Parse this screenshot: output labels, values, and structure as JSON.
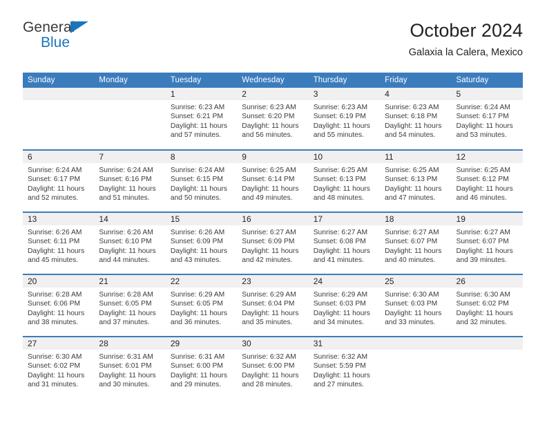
{
  "logo": {
    "word1": "General",
    "word2": "Blue",
    "triangle_color": "#1b75bb"
  },
  "header": {
    "title": "October 2024",
    "subtitle": "Galaxia la Calera, Mexico"
  },
  "colors": {
    "header_blue": "#3b7cbd",
    "daynum_band": "#f0f0f0",
    "text": "#231f20"
  },
  "weekday_headers": [
    "Sunday",
    "Monday",
    "Tuesday",
    "Wednesday",
    "Thursday",
    "Friday",
    "Saturday"
  ],
  "labels": {
    "sunrise_prefix": "Sunrise:",
    "sunset_prefix": "Sunset:",
    "daylight_prefix": "Daylight:"
  },
  "weeks": [
    [
      {
        "day": "",
        "empty": true
      },
      {
        "day": "",
        "empty": true
      },
      {
        "day": "1",
        "sunrise": "Sunrise: 6:23 AM",
        "sunset": "Sunset: 6:21 PM",
        "daylight": "Daylight: 11 hours and 57 minutes."
      },
      {
        "day": "2",
        "sunrise": "Sunrise: 6:23 AM",
        "sunset": "Sunset: 6:20 PM",
        "daylight": "Daylight: 11 hours and 56 minutes."
      },
      {
        "day": "3",
        "sunrise": "Sunrise: 6:23 AM",
        "sunset": "Sunset: 6:19 PM",
        "daylight": "Daylight: 11 hours and 55 minutes."
      },
      {
        "day": "4",
        "sunrise": "Sunrise: 6:23 AM",
        "sunset": "Sunset: 6:18 PM",
        "daylight": "Daylight: 11 hours and 54 minutes."
      },
      {
        "day": "5",
        "sunrise": "Sunrise: 6:24 AM",
        "sunset": "Sunset: 6:17 PM",
        "daylight": "Daylight: 11 hours and 53 minutes."
      }
    ],
    [
      {
        "day": "6",
        "sunrise": "Sunrise: 6:24 AM",
        "sunset": "Sunset: 6:17 PM",
        "daylight": "Daylight: 11 hours and 52 minutes."
      },
      {
        "day": "7",
        "sunrise": "Sunrise: 6:24 AM",
        "sunset": "Sunset: 6:16 PM",
        "daylight": "Daylight: 11 hours and 51 minutes."
      },
      {
        "day": "8",
        "sunrise": "Sunrise: 6:24 AM",
        "sunset": "Sunset: 6:15 PM",
        "daylight": "Daylight: 11 hours and 50 minutes."
      },
      {
        "day": "9",
        "sunrise": "Sunrise: 6:25 AM",
        "sunset": "Sunset: 6:14 PM",
        "daylight": "Daylight: 11 hours and 49 minutes."
      },
      {
        "day": "10",
        "sunrise": "Sunrise: 6:25 AM",
        "sunset": "Sunset: 6:13 PM",
        "daylight": "Daylight: 11 hours and 48 minutes."
      },
      {
        "day": "11",
        "sunrise": "Sunrise: 6:25 AM",
        "sunset": "Sunset: 6:13 PM",
        "daylight": "Daylight: 11 hours and 47 minutes."
      },
      {
        "day": "12",
        "sunrise": "Sunrise: 6:25 AM",
        "sunset": "Sunset: 6:12 PM",
        "daylight": "Daylight: 11 hours and 46 minutes."
      }
    ],
    [
      {
        "day": "13",
        "sunrise": "Sunrise: 6:26 AM",
        "sunset": "Sunset: 6:11 PM",
        "daylight": "Daylight: 11 hours and 45 minutes."
      },
      {
        "day": "14",
        "sunrise": "Sunrise: 6:26 AM",
        "sunset": "Sunset: 6:10 PM",
        "daylight": "Daylight: 11 hours and 44 minutes."
      },
      {
        "day": "15",
        "sunrise": "Sunrise: 6:26 AM",
        "sunset": "Sunset: 6:09 PM",
        "daylight": "Daylight: 11 hours and 43 minutes."
      },
      {
        "day": "16",
        "sunrise": "Sunrise: 6:27 AM",
        "sunset": "Sunset: 6:09 PM",
        "daylight": "Daylight: 11 hours and 42 minutes."
      },
      {
        "day": "17",
        "sunrise": "Sunrise: 6:27 AM",
        "sunset": "Sunset: 6:08 PM",
        "daylight": "Daylight: 11 hours and 41 minutes."
      },
      {
        "day": "18",
        "sunrise": "Sunrise: 6:27 AM",
        "sunset": "Sunset: 6:07 PM",
        "daylight": "Daylight: 11 hours and 40 minutes."
      },
      {
        "day": "19",
        "sunrise": "Sunrise: 6:27 AM",
        "sunset": "Sunset: 6:07 PM",
        "daylight": "Daylight: 11 hours and 39 minutes."
      }
    ],
    [
      {
        "day": "20",
        "sunrise": "Sunrise: 6:28 AM",
        "sunset": "Sunset: 6:06 PM",
        "daylight": "Daylight: 11 hours and 38 minutes."
      },
      {
        "day": "21",
        "sunrise": "Sunrise: 6:28 AM",
        "sunset": "Sunset: 6:05 PM",
        "daylight": "Daylight: 11 hours and 37 minutes."
      },
      {
        "day": "22",
        "sunrise": "Sunrise: 6:29 AM",
        "sunset": "Sunset: 6:05 PM",
        "daylight": "Daylight: 11 hours and 36 minutes."
      },
      {
        "day": "23",
        "sunrise": "Sunrise: 6:29 AM",
        "sunset": "Sunset: 6:04 PM",
        "daylight": "Daylight: 11 hours and 35 minutes."
      },
      {
        "day": "24",
        "sunrise": "Sunrise: 6:29 AM",
        "sunset": "Sunset: 6:03 PM",
        "daylight": "Daylight: 11 hours and 34 minutes."
      },
      {
        "day": "25",
        "sunrise": "Sunrise: 6:30 AM",
        "sunset": "Sunset: 6:03 PM",
        "daylight": "Daylight: 11 hours and 33 minutes."
      },
      {
        "day": "26",
        "sunrise": "Sunrise: 6:30 AM",
        "sunset": "Sunset: 6:02 PM",
        "daylight": "Daylight: 11 hours and 32 minutes."
      }
    ],
    [
      {
        "day": "27",
        "sunrise": "Sunrise: 6:30 AM",
        "sunset": "Sunset: 6:02 PM",
        "daylight": "Daylight: 11 hours and 31 minutes."
      },
      {
        "day": "28",
        "sunrise": "Sunrise: 6:31 AM",
        "sunset": "Sunset: 6:01 PM",
        "daylight": "Daylight: 11 hours and 30 minutes."
      },
      {
        "day": "29",
        "sunrise": "Sunrise: 6:31 AM",
        "sunset": "Sunset: 6:00 PM",
        "daylight": "Daylight: 11 hours and 29 minutes."
      },
      {
        "day": "30",
        "sunrise": "Sunrise: 6:32 AM",
        "sunset": "Sunset: 6:00 PM",
        "daylight": "Daylight: 11 hours and 28 minutes."
      },
      {
        "day": "31",
        "sunrise": "Sunrise: 6:32 AM",
        "sunset": "Sunset: 5:59 PM",
        "daylight": "Daylight: 11 hours and 27 minutes."
      },
      {
        "day": "",
        "empty": true
      },
      {
        "day": "",
        "empty": true
      }
    ]
  ]
}
